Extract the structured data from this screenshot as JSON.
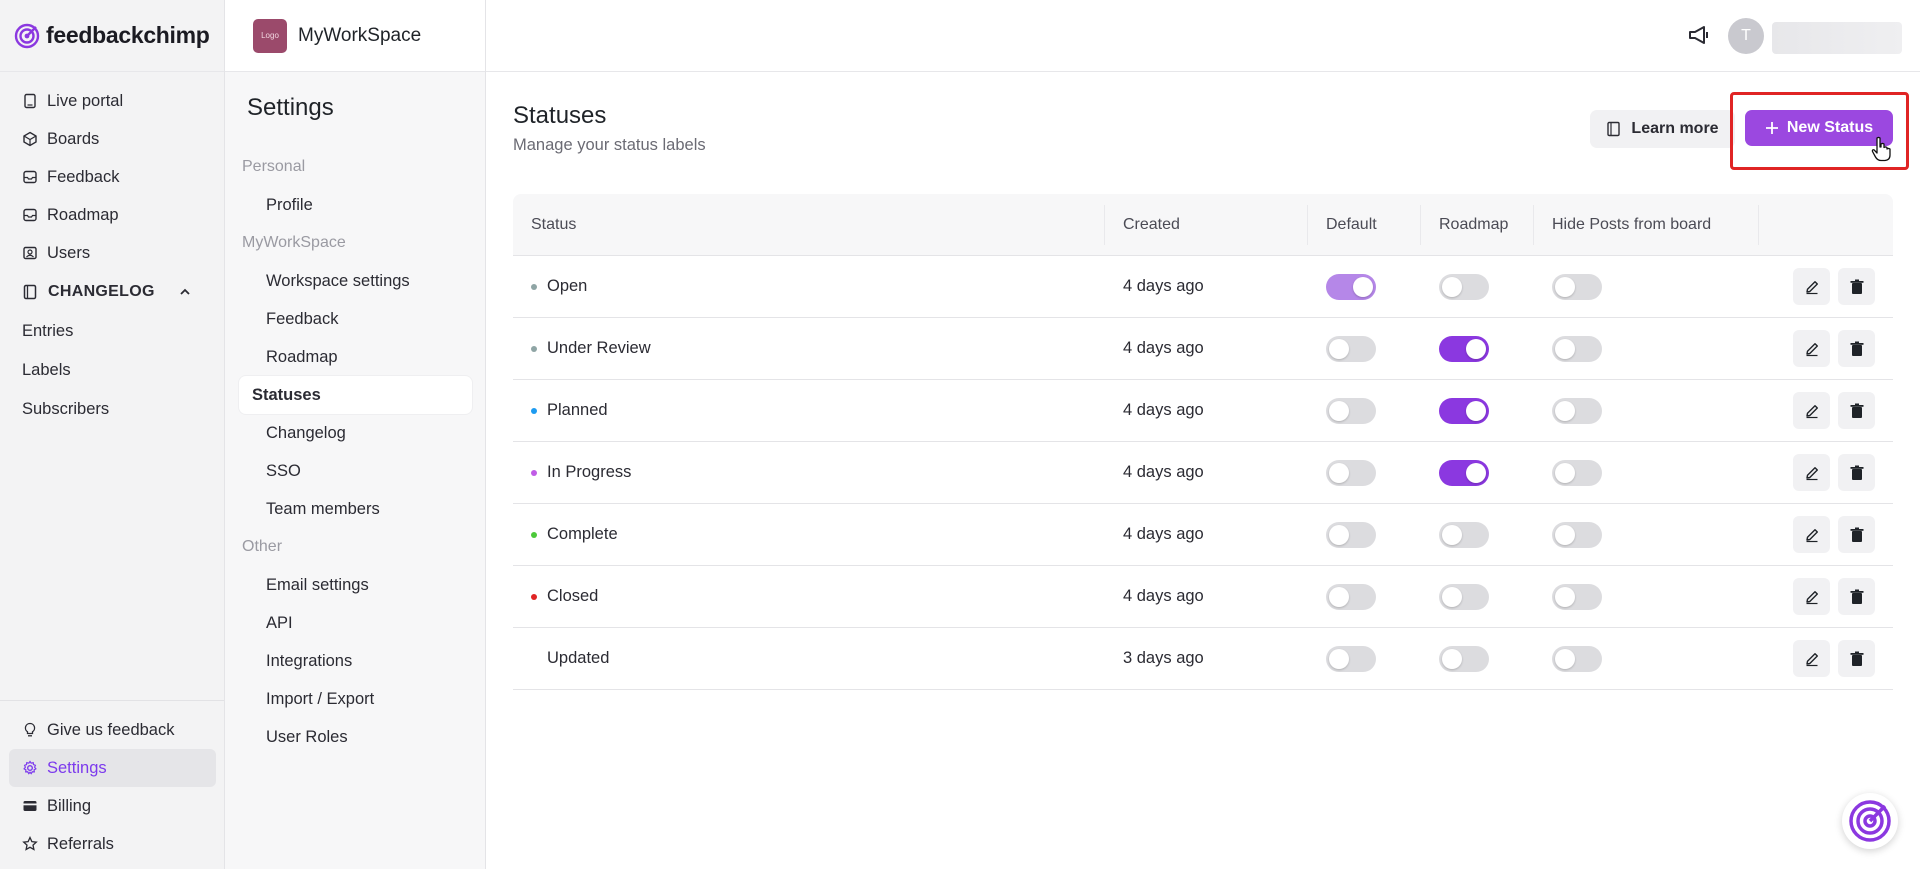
{
  "brand": {
    "name": "feedbackchimp"
  },
  "nav": {
    "items": [
      {
        "label": "Live portal",
        "icon": "file-icon"
      },
      {
        "label": "Boards",
        "icon": "boards-icon"
      },
      {
        "label": "Feedback",
        "icon": "inbox-icon"
      },
      {
        "label": "Roadmap",
        "icon": "inbox-icon"
      },
      {
        "label": "Users",
        "icon": "users-icon"
      }
    ],
    "changelog": {
      "label": "CHANGELOG",
      "items": [
        "Entries",
        "Labels",
        "Subscribers"
      ]
    },
    "bottom": [
      {
        "label": "Give us feedback",
        "icon": "lightbulb-icon"
      },
      {
        "label": "Settings",
        "icon": "gear-icon"
      },
      {
        "label": "Billing",
        "icon": "card-icon"
      },
      {
        "label": "Referrals",
        "icon": "star-icon"
      }
    ]
  },
  "workspace": {
    "name": "MyWorkSpace",
    "logo_text": "Logo"
  },
  "settings": {
    "title": "Settings",
    "personal_label": "Personal",
    "personal_items": [
      "Profile"
    ],
    "workspace_label": "MyWorkSpace",
    "workspace_items": [
      "Workspace settings",
      "Feedback",
      "Roadmap",
      "Statuses",
      "Changelog",
      "SSO",
      "Team members"
    ],
    "other_label": "Other",
    "other_items": [
      "Email settings",
      "API",
      "Integrations",
      "Import / Export",
      "User Roles"
    ]
  },
  "topbar": {
    "avatar_initial": "T"
  },
  "page": {
    "title": "Statuses",
    "subtitle": "Manage your status labels",
    "learn_more": "Learn more",
    "new_status": "New Status"
  },
  "table": {
    "headers": [
      "Status",
      "Created",
      "Default",
      "Roadmap",
      "Hide Posts from board"
    ],
    "rows": [
      {
        "name": "Open",
        "color": "#8fa5a5",
        "created": "4 days ago",
        "default": true,
        "roadmap": false,
        "hide": false
      },
      {
        "name": "Under Review",
        "color": "#8fa5a5",
        "created": "4 days ago",
        "default": false,
        "roadmap": true,
        "hide": false
      },
      {
        "name": "Planned",
        "color": "#1d9bf0",
        "created": "4 days ago",
        "default": false,
        "roadmap": true,
        "hide": false
      },
      {
        "name": "In Progress",
        "color": "#c05ce6",
        "created": "4 days ago",
        "default": false,
        "roadmap": true,
        "hide": false
      },
      {
        "name": "Complete",
        "color": "#4cc93a",
        "created": "4 days ago",
        "default": false,
        "roadmap": false,
        "hide": false
      },
      {
        "name": "Closed",
        "color": "#e02424",
        "created": "4 days ago",
        "default": false,
        "roadmap": false,
        "hide": false
      },
      {
        "name": "Updated",
        "color": "",
        "created": "3 days ago",
        "default": false,
        "roadmap": false,
        "hide": false
      }
    ]
  }
}
